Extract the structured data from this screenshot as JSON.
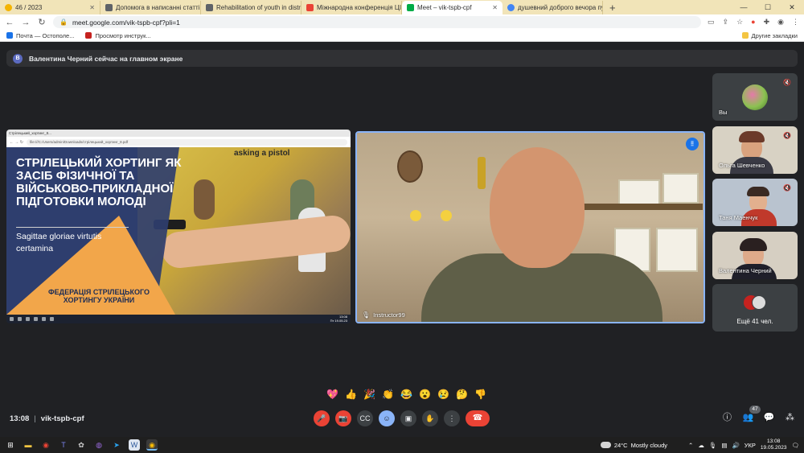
{
  "browser": {
    "tabs": [
      {
        "title": "46 / 2023",
        "favicon_color": "#f4b400",
        "active": false
      },
      {
        "title": "Допомога в написанні статті",
        "favicon_color": "#5f6368",
        "active": false
      },
      {
        "title": "Rehabilitation of youth in distress",
        "favicon_color": "#5f6368",
        "active": false
      },
      {
        "title": "Міжнародна конференція ЦІЗ",
        "favicon_color": "#ea4335",
        "active": false
      },
      {
        "title": "Meet – vik-tspb-cpf",
        "favicon_color": "#00ac47",
        "active": true
      },
      {
        "title": "душевний доброго вечора пу...",
        "favicon_color": "#4285f4",
        "active": false
      }
    ],
    "new_tab_label": "+",
    "url": "meet.google.com/vik-tspb-cpf?pli=1",
    "bookmarks": [
      {
        "label": "Почта — Остополе...",
        "color": "#1a73e8"
      },
      {
        "label": "Просмотр инструк...",
        "color": "#c5221f"
      }
    ],
    "other_bookmarks": "Другие закладки"
  },
  "meet": {
    "banner_initial": "В",
    "banner_text": "Валентина Черний сейчас на главном экране",
    "shared_screen": {
      "mini_tab": "Стрілецький_хортинг_8...",
      "mini_url": "file:///C:/Users/admin/Downloads/стрілецький_хортинг_8.pdf",
      "slide_title": "СТРІЛЕЦЬКИЙ ХОРТИНГ ЯК ЗАСІБ ФІЗИЧНОЇ ТА ВІЙСЬКОВО-ПРИКЛАДНОЇ ПІДГОТОВКИ МОЛОДІ",
      "slide_subtitle_1": "Sagittae gloriae virtutis",
      "slide_subtitle_2": "certamina",
      "slide_photo_sign": "asking a pistol",
      "slide_federation": "ФЕДЕРАЦІЯ СТРІЛЕЦЬКОГО ХОРТИНГУ УКРАЇНИ",
      "mini_clock_time": "13:08",
      "mini_clock_date": "Пт 19.05.23"
    },
    "speaker": {
      "name": "Instructor99",
      "audio_indicator": "⦙⦙"
    },
    "participants": [
      {
        "name": "Вы",
        "muted": true
      },
      {
        "name": "Ольга Шевченко",
        "muted": true
      },
      {
        "name": "Таня Маенчук",
        "muted": true
      },
      {
        "name": "Валентина Черний",
        "muted": false
      }
    ],
    "more_label": "Ещё 41 чел.",
    "reactions": [
      "💖",
      "👍",
      "🎉",
      "👏",
      "😂",
      "😮",
      "😢",
      "🤔",
      "👎"
    ],
    "time": "13:08",
    "meeting_code": "vik-tspb-cpf",
    "controls": [
      {
        "name": "mic-off",
        "glyph": "🎤"
      },
      {
        "name": "camera-off",
        "glyph": "📷"
      },
      {
        "name": "captions",
        "glyph": "CC"
      },
      {
        "name": "reactions",
        "glyph": "☺"
      },
      {
        "name": "present",
        "glyph": "▣"
      },
      {
        "name": "raise-hand",
        "glyph": "✋"
      },
      {
        "name": "more-options",
        "glyph": "⋮"
      },
      {
        "name": "leave-call",
        "glyph": "☎"
      }
    ],
    "people_count": "47"
  },
  "taskbar": {
    "temperature": "24°C",
    "weather": "Mostly cloudy",
    "language": "УКР",
    "time": "13:08",
    "date": "19.05.2023"
  }
}
